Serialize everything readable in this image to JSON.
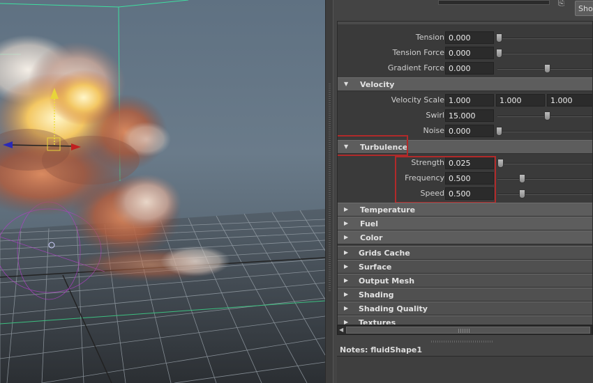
{
  "toolbar": {
    "show_label": "Show"
  },
  "attributes_top": [
    {
      "label": "Tension",
      "value": "0.000",
      "slider": 0.0
    },
    {
      "label": "Tension Force",
      "value": "0.000",
      "slider": 0.0
    },
    {
      "label": "Gradient Force",
      "value": "0.000",
      "slider": 0.5
    }
  ],
  "velocity": {
    "title": "Velocity",
    "expanded": true,
    "scale": {
      "label": "Velocity Scale",
      "values": [
        "1.000",
        "1.000",
        "1.000"
      ]
    },
    "swirl": {
      "label": "Swirl",
      "value": "15.000",
      "slider": 0.5
    },
    "noise": {
      "label": "Noise",
      "value": "0.000",
      "slider": 0.0
    }
  },
  "turbulence": {
    "title": "Turbulence",
    "expanded": true,
    "rows": [
      {
        "label": "Strength",
        "value": "0.025",
        "slider": 0.025
      },
      {
        "label": "Frequency",
        "value": "0.500",
        "slider": 0.2
      },
      {
        "label": "Speed",
        "value": "0.500",
        "slider": 0.2
      }
    ]
  },
  "sub_sections": [
    "Temperature",
    "Fuel",
    "Color"
  ],
  "sections": [
    "Grids Cache",
    "Surface",
    "Output Mesh",
    "Shading",
    "Shading Quality",
    "Textures"
  ],
  "notes": {
    "label": "Notes:  fluidShape1"
  },
  "colors": {
    "highlight": "#b12a2a",
    "panel": "#444444",
    "section_header": "#5d5d5d"
  },
  "icons": {
    "expanded": "triangle-down-icon",
    "collapsed": "triangle-right-icon"
  }
}
